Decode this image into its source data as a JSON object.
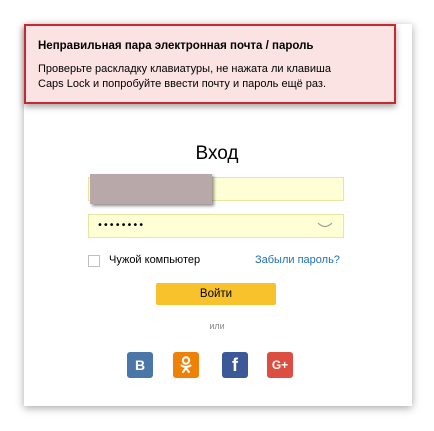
{
  "error": {
    "title": "Неправильная пара электронная почта / пароль",
    "line1": "Проверьте раскладку клавиатуры, не нажата ли клавиша",
    "line2": "Caps Lock и попробуйте ввести почту и пароль ещё раз."
  },
  "form": {
    "title": "Вход",
    "login_value": "",
    "password_value": "••••••••",
    "checkbox_label": "Чужой компьютер",
    "forgot_link": "Забыли пароль?",
    "submit_label": "Войти",
    "or_text": "или"
  },
  "social": {
    "vk_label": "В",
    "ok_label": "ок",
    "fb_label": "f",
    "gp_label": "G+"
  },
  "colors": {
    "error_border": "#c8282e",
    "error_background": "#fbe3e4",
    "field_background": "#ffffd6",
    "button_yellow": "#f8c22c",
    "link_blue": "#1f6fb4",
    "vk": "#4a76a8",
    "ok": "#ee8208",
    "facebook": "#3b5998",
    "google_plus": "#dc4e41"
  },
  "icons": {
    "password_toggle": "eye-closed-icon",
    "vk": "vk-icon",
    "odnoklassniki": "odnoklassniki-icon",
    "facebook": "facebook-icon",
    "google_plus": "google-plus-icon"
  }
}
